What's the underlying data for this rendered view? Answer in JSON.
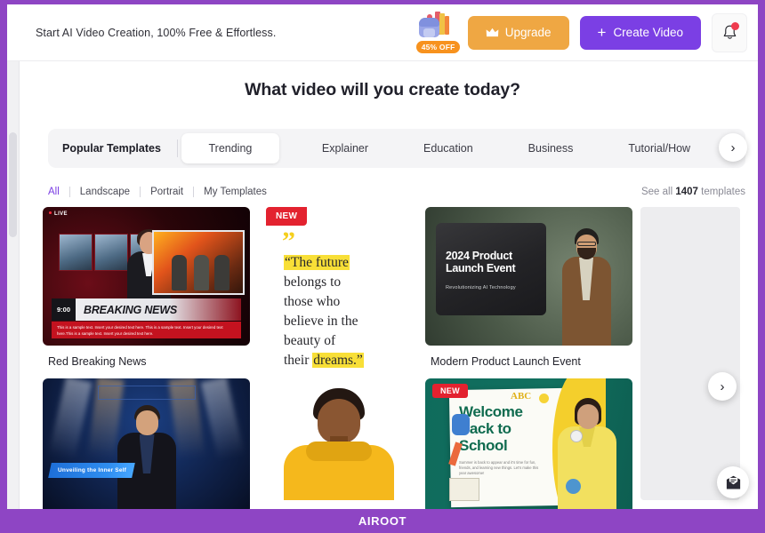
{
  "brand": {
    "name": "AIROOT",
    "accent": "#8e45c4",
    "primary": "#7b3fe4",
    "upgrade": "#efa743"
  },
  "topbar": {
    "promo_text": "Start AI Video Creation, 100% Free & Effortless.",
    "sale_badge": "45% OFF",
    "upgrade_label": "Upgrade",
    "create_video_label": "Create Video",
    "plus": "+"
  },
  "heading": {
    "title": "What video will you create today?"
  },
  "tabs": {
    "head_label": "Popular Templates",
    "items": [
      {
        "label": "Trending"
      },
      {
        "label": "Explainer"
      },
      {
        "label": "Education"
      },
      {
        "label": "Business"
      },
      {
        "label": "Tutorial/How"
      }
    ],
    "next_glyph": "›"
  },
  "filters": {
    "items": [
      {
        "label": "All"
      },
      {
        "label": "Landscape"
      },
      {
        "label": "Portrait"
      },
      {
        "label": "My Templates"
      }
    ],
    "see_all_prefix": "See all",
    "template_count": "1407",
    "see_all_suffix": "templates"
  },
  "grid": {
    "next_glyph": "›",
    "cards": {
      "news": {
        "caption": "Red Breaking News",
        "live": "LIVE",
        "time": "9:00",
        "headline": "BREAKING NEWS",
        "ticker": "This is a sample text. Insert your desired text here. This is a sample text. Insert your desired text here.This is a sample text. Insert your desired text here."
      },
      "quote": {
        "badge": "NEW",
        "quote_mark": "”",
        "line1": "“The future",
        "line2": "belongs to",
        "line3": "those who",
        "line4": "believe in the",
        "line5": "beauty of",
        "line6a": "their ",
        "line6b": "dreams.”"
      },
      "launch": {
        "caption": "Modern Product Launch Event",
        "title_line1": "2024 Product",
        "title_line2": "Launch Event",
        "subtitle": "Revolutionizing AI Technology"
      },
      "stage": {
        "lower_third": "Unveiling the Inner Self"
      },
      "school": {
        "badge": "NEW",
        "abc": "ABC",
        "title_line1": "Welcome",
        "title_line2": "Back to",
        "title_line3": "School",
        "body": "Summer is back to appear and it's time for fun, friends, and learning new things. Let's make this year awesome!"
      }
    }
  }
}
